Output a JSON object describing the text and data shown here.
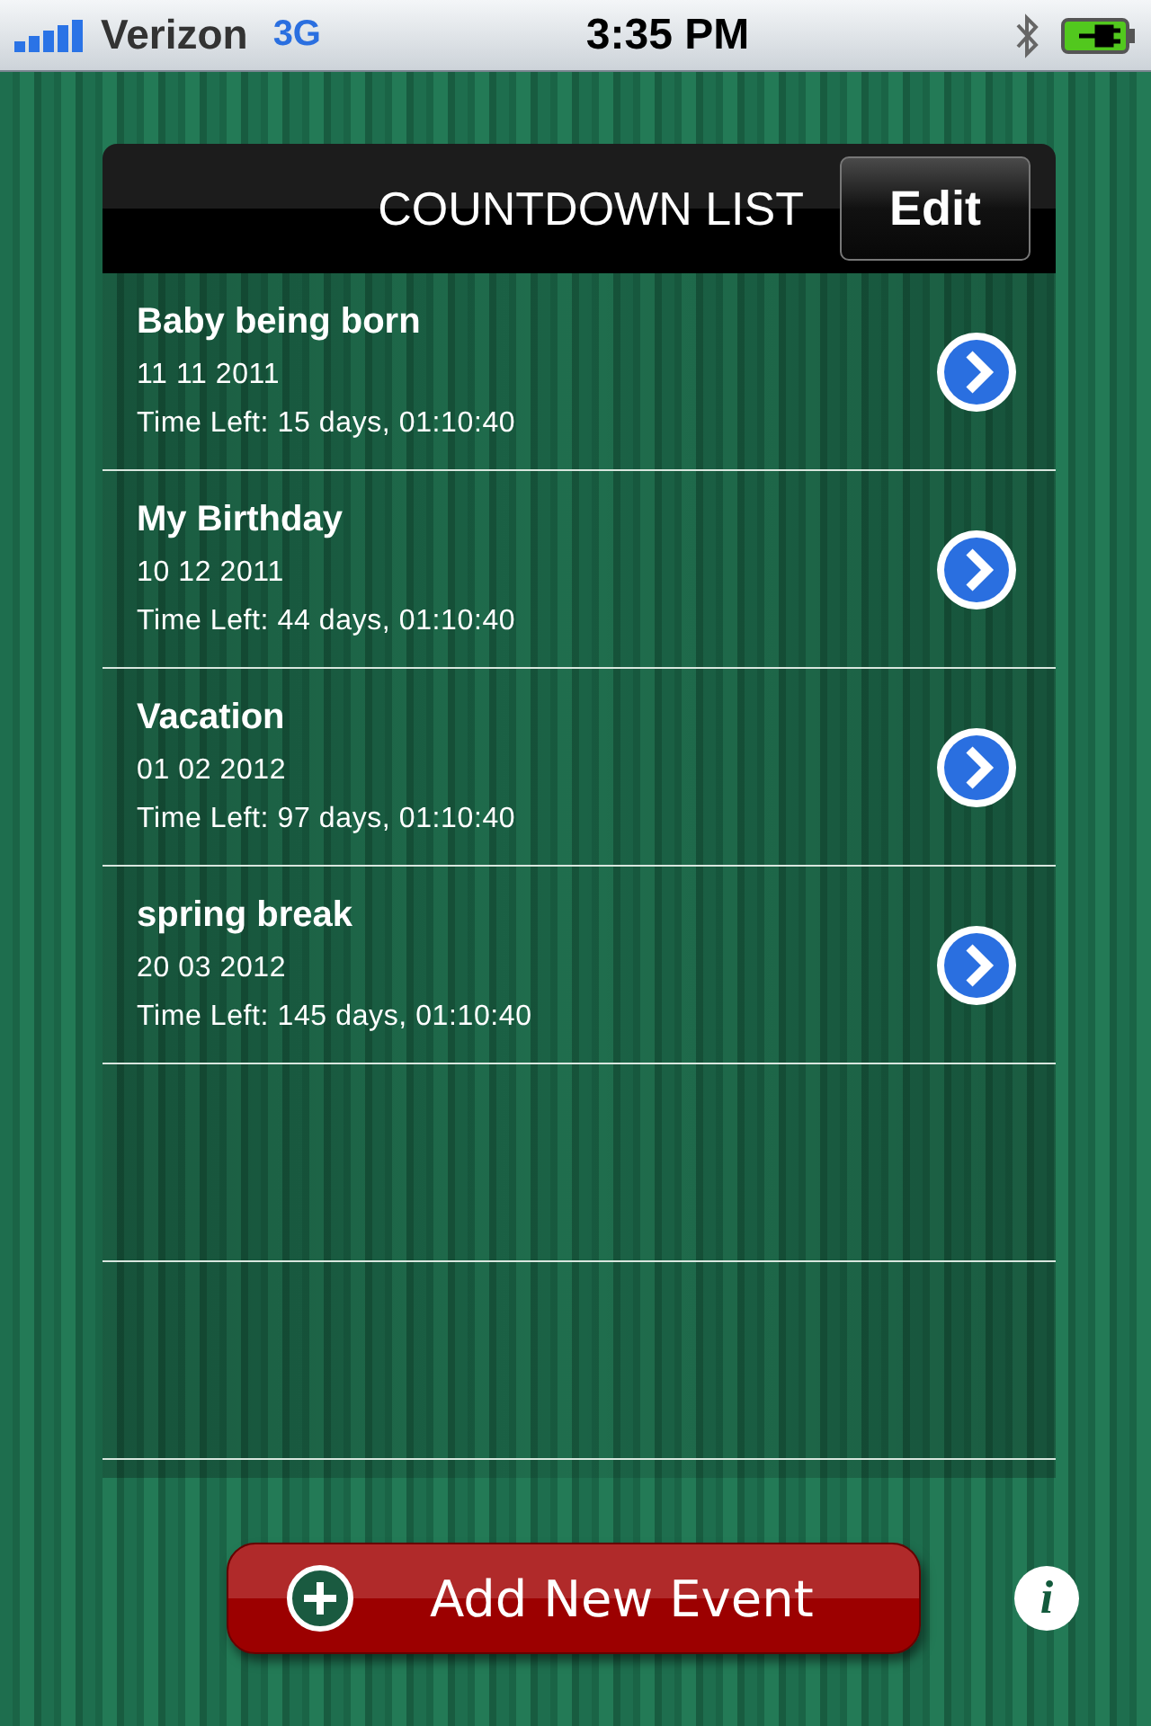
{
  "status_bar": {
    "carrier": "Verizon",
    "network": "3G",
    "time": "3:35 PM"
  },
  "header": {
    "title": "COUNTDOWN LIST",
    "edit_button": "Edit"
  },
  "events": [
    {
      "name": "Baby being born",
      "date": "11 11 2011",
      "time_left": "Time Left: 15 days, 01:10:40"
    },
    {
      "name": "My Birthday",
      "date": "10 12 2011",
      "time_left": "Time Left: 44 days, 01:10:40"
    },
    {
      "name": "Vacation",
      "date": "01 02 2012",
      "time_left": "Time Left: 97 days, 01:10:40"
    },
    {
      "name": "spring break",
      "date": "20 03 2012",
      "time_left": "Time Left: 145 days, 01:10:40"
    }
  ],
  "add_button": "Add New Event",
  "info_button": "i"
}
